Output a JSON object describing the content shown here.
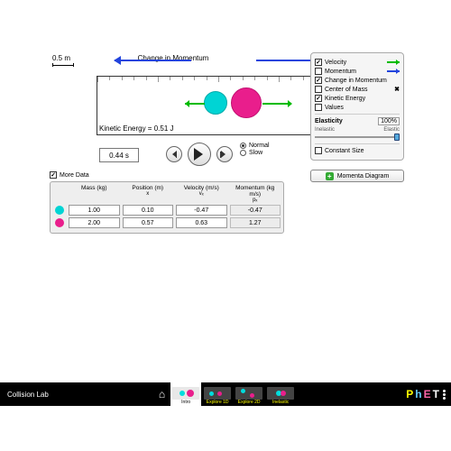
{
  "sim": {
    "scale_label": "0.5 m",
    "change_label": "Change in Momentum",
    "ke_label": "Kinetic Energy = 0.51 J",
    "time": "0.44 s",
    "speed": {
      "normal": "Normal",
      "slow": "Slow",
      "selected": "normal"
    }
  },
  "panel": {
    "velocity": "Velocity",
    "momentum": "Momentum",
    "change_in_momentum": "Change in Momentum",
    "center_of_mass": "Center of Mass",
    "kinetic_energy": "Kinetic Energy",
    "values": "Values",
    "elasticity_label": "Elasticity",
    "elasticity_value": "100%",
    "inelastic": "Inelastic",
    "elastic": "Elastic",
    "constant_size": "Constant Size",
    "checked": {
      "velocity": true,
      "momentum": false,
      "change": true,
      "com": false,
      "ke": true,
      "values": false,
      "constant": false
    }
  },
  "momenta_button": "Momenta Diagram",
  "more_data_label": "More Data",
  "table": {
    "headers": {
      "mass": "Mass (kg)",
      "position": "Position (m)",
      "position_sub": "x",
      "velocity": "Velocity (m/s)",
      "velocity_sub": "vₓ",
      "momentum": "Momentum (kg m/s)",
      "momentum_sub": "pₓ"
    },
    "rows": [
      {
        "color": "#00d4d4",
        "mass": "1.00",
        "position": "0.10",
        "velocity": "-0.47",
        "momentum": "-0.47"
      },
      {
        "color": "#e91e8c",
        "mass": "2.00",
        "position": "0.57",
        "velocity": "0.63",
        "momentum": "1.27"
      }
    ]
  },
  "nav": {
    "title": "Collision Lab",
    "tabs": [
      {
        "label": "Intro",
        "selected": true
      },
      {
        "label": "Explore 1D",
        "selected": false
      },
      {
        "label": "Explore 2D",
        "selected": false
      },
      {
        "label": "Inelastic",
        "selected": false
      }
    ],
    "logo": "PhET"
  }
}
